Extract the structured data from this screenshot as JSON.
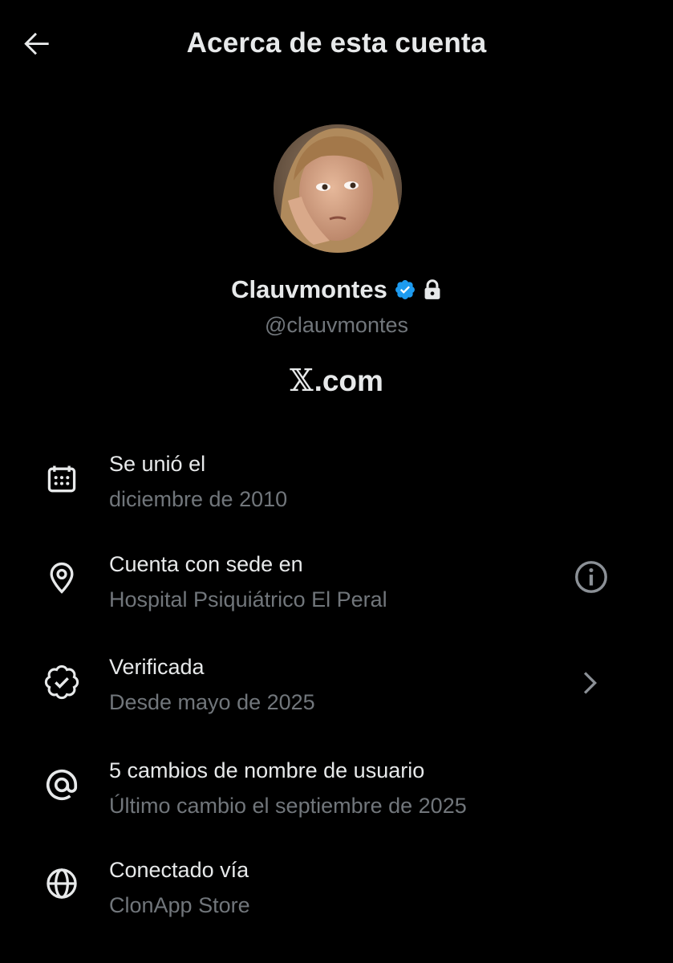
{
  "header": {
    "title": "Acerca de esta cuenta",
    "back_icon": "arrow-left-icon"
  },
  "profile": {
    "display_name": "Clauvmontes",
    "handle": "@clauvmontes",
    "verified_icon": "verified-badge-icon",
    "protected_icon": "lock-icon",
    "site_logo": "𝕏",
    "site_suffix": ".com"
  },
  "items": [
    {
      "icon": "calendar-icon",
      "title": "Se unió el",
      "subtitle": "diciembre de 2010"
    },
    {
      "icon": "location-pin-icon",
      "title": "Cuenta con sede en",
      "subtitle": "Hospital Psiquiátrico El Peral",
      "trailing_icon": "info-icon"
    },
    {
      "icon": "verified-seal-icon",
      "title": "Verificada",
      "subtitle": "Desde mayo de 2025",
      "trailing_icon": "chevron-right-icon"
    },
    {
      "icon": "at-sign-icon",
      "title": "5 cambios de nombre de usuario",
      "subtitle": "Último cambio el septiembre de 2025"
    },
    {
      "icon": "globe-icon",
      "title": "Conectado vía",
      "subtitle": "ClonApp Store"
    }
  ],
  "colors": {
    "background": "#000000",
    "primary_text": "#e7e9ea",
    "secondary_text": "#71767b",
    "verified_blue": "#1d9bf0"
  }
}
